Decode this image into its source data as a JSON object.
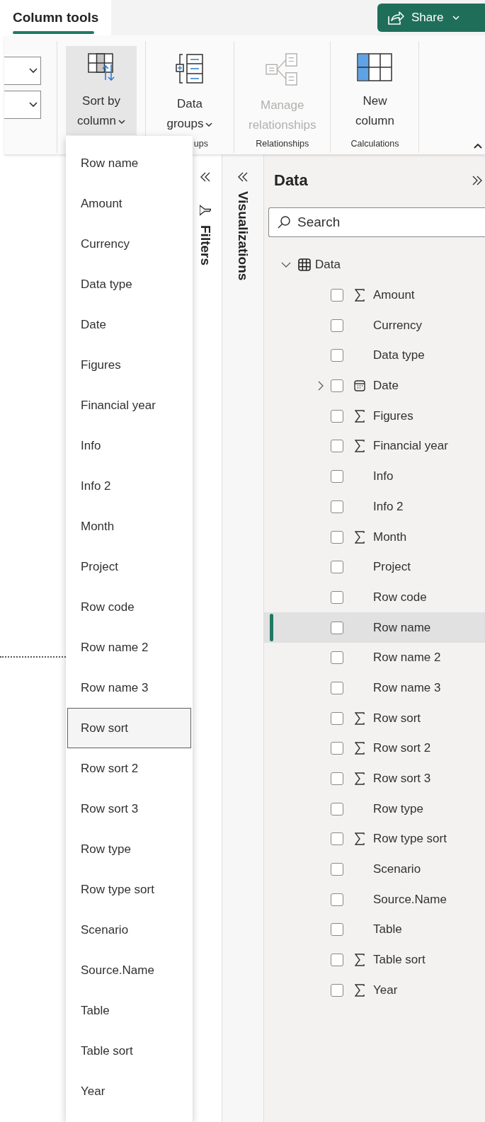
{
  "tabs": [
    {
      "label": "Column tools",
      "selected": true
    }
  ],
  "share": {
    "label": "Share"
  },
  "ribbon": {
    "groups": [
      {
        "controls": [
          {
            "kind": "dropdown"
          },
          {
            "kind": "dropdown"
          }
        ]
      },
      {
        "controls": [
          {
            "kind": "large_button",
            "lines": [
              "Sort by",
              "column"
            ],
            "has_menu": true,
            "selected": true,
            "disabled": false
          }
        ]
      },
      {
        "label": "ups",
        "controls": [
          {
            "kind": "large_button",
            "lines": [
              "Data",
              "groups"
            ],
            "has_menu": true,
            "selected": false,
            "disabled": false
          }
        ]
      },
      {
        "label": "Relationships",
        "controls": [
          {
            "kind": "large_button",
            "lines": [
              "Manage",
              "relationships"
            ],
            "has_menu": false,
            "selected": false,
            "disabled": true
          }
        ]
      },
      {
        "label": "Calculations",
        "controls": [
          {
            "kind": "large_button",
            "lines": [
              "New",
              "column"
            ],
            "has_menu": false,
            "selected": false,
            "disabled": false
          }
        ]
      }
    ]
  },
  "sort_menu": {
    "items": [
      {
        "label": "Row name",
        "hovered": false
      },
      {
        "label": "Amount",
        "hovered": false
      },
      {
        "label": "Currency",
        "hovered": false
      },
      {
        "label": "Data type",
        "hovered": false
      },
      {
        "label": "Date",
        "hovered": false
      },
      {
        "label": "Figures",
        "hovered": false
      },
      {
        "label": "Financial year",
        "hovered": false
      },
      {
        "label": "Info",
        "hovered": false
      },
      {
        "label": "Info 2",
        "hovered": false
      },
      {
        "label": "Month",
        "hovered": false
      },
      {
        "label": "Project",
        "hovered": false
      },
      {
        "label": "Row code",
        "hovered": false
      },
      {
        "label": "Row name 2",
        "hovered": false
      },
      {
        "label": "Row name 3",
        "hovered": false
      },
      {
        "label": "Row sort",
        "hovered": true
      },
      {
        "label": "Row sort 2",
        "hovered": false
      },
      {
        "label": "Row sort 3",
        "hovered": false
      },
      {
        "label": "Row type",
        "hovered": false
      },
      {
        "label": "Row type sort",
        "hovered": false
      },
      {
        "label": "Scenario",
        "hovered": false
      },
      {
        "label": "Source.Name",
        "hovered": false
      },
      {
        "label": "Table",
        "hovered": false
      },
      {
        "label": "Table sort",
        "hovered": false
      },
      {
        "label": "Year",
        "hovered": false
      }
    ]
  },
  "filters_pane": {
    "title": "Filters"
  },
  "visualizations_pane": {
    "title": "Visualizations"
  },
  "data_pane": {
    "title": "Data",
    "search": {
      "placeholder": "Search"
    },
    "tree": [
      {
        "label": "Data",
        "kind": "table",
        "expanded": true,
        "children": [
          {
            "label": "Amount",
            "kind": "sum",
            "checked": false,
            "selected": false
          },
          {
            "label": "Currency",
            "kind": "text",
            "checked": false,
            "selected": false
          },
          {
            "label": "Data type",
            "kind": "text",
            "checked": false,
            "selected": false
          },
          {
            "label": "Date",
            "kind": "date",
            "expanded": false,
            "checked": false,
            "selected": false
          },
          {
            "label": "Figures",
            "kind": "sum",
            "checked": false,
            "selected": false
          },
          {
            "label": "Financial year",
            "kind": "sum",
            "checked": false,
            "selected": false
          },
          {
            "label": "Info",
            "kind": "text",
            "checked": false,
            "selected": false
          },
          {
            "label": "Info 2",
            "kind": "text",
            "checked": false,
            "selected": false
          },
          {
            "label": "Month",
            "kind": "sum",
            "checked": false,
            "selected": false
          },
          {
            "label": "Project",
            "kind": "text",
            "checked": false,
            "selected": false
          },
          {
            "label": "Row code",
            "kind": "text",
            "checked": false,
            "selected": false
          },
          {
            "label": "Row name",
            "kind": "text",
            "checked": false,
            "selected": true
          },
          {
            "label": "Row name 2",
            "kind": "text",
            "checked": false,
            "selected": false
          },
          {
            "label": "Row name 3",
            "kind": "text",
            "checked": false,
            "selected": false
          },
          {
            "label": "Row sort",
            "kind": "sum",
            "checked": false,
            "selected": false
          },
          {
            "label": "Row sort 2",
            "kind": "sum",
            "checked": false,
            "selected": false
          },
          {
            "label": "Row sort 3",
            "kind": "sum",
            "checked": false,
            "selected": false
          },
          {
            "label": "Row type",
            "kind": "text",
            "checked": false,
            "selected": false
          },
          {
            "label": "Row type sort",
            "kind": "sum",
            "checked": false,
            "selected": false
          },
          {
            "label": "Scenario",
            "kind": "text",
            "checked": false,
            "selected": false
          },
          {
            "label": "Source.Name",
            "kind": "text",
            "checked": false,
            "selected": false
          },
          {
            "label": "Table",
            "kind": "text",
            "checked": false,
            "selected": false
          },
          {
            "label": "Table sort",
            "kind": "sum",
            "checked": false,
            "selected": false
          },
          {
            "label": "Year",
            "kind": "sum",
            "checked": false,
            "selected": false
          }
        ]
      }
    ]
  }
}
